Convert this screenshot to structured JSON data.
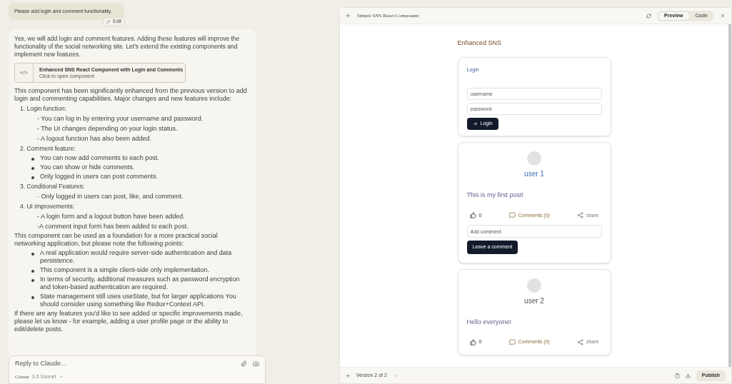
{
  "chat": {
    "user_message": "Please add login and comment functionality.",
    "edit_button": "Edit",
    "intro": "Yes, we will add login and comment features. Adding these features will improve the functionality of the social networking site. Let's extend the existing components and implement new features.",
    "artifact": {
      "icon": "</>",
      "title": "Enhanced SNS React Component with Login and Comments",
      "subtitle": "Click to open component"
    },
    "blocks": [
      {
        "kind": "para",
        "text": "This component has been significantly enhanced from the previous version to add login and commenting capabilities. Major changes and new features include:"
      },
      {
        "kind": "heading",
        "text": "1. Login function:"
      },
      {
        "kind": "dash",
        "text": "- You can log in by entering your username and password."
      },
      {
        "kind": "dash",
        "text": "- The UI changes depending on your login status."
      },
      {
        "kind": "dash",
        "text": "- A logout function has also been added."
      },
      {
        "kind": "heading",
        "text": "2. Comment feature:"
      },
      {
        "kind": "bullet",
        "text": "You can now add comments to each post."
      },
      {
        "kind": "bullet",
        "text": "You can show or hide comments."
      },
      {
        "kind": "bullet",
        "text": "Only logged in users can post comments."
      },
      {
        "kind": "heading",
        "text": "3. Conditional Features:"
      },
      {
        "kind": "dash",
        "text": "· Only logged in users can post, like, and comment."
      },
      {
        "kind": "heading",
        "text": "4. UI improvements:"
      },
      {
        "kind": "dash",
        "text": "- A login form and a logout button have been added."
      },
      {
        "kind": "dash",
        "text": "-A comment input form has been added to each post."
      },
      {
        "kind": "para",
        "text": "This component can be used as a foundation for a more practical social networking application, but please note the following points:"
      },
      {
        "kind": "bullet",
        "text": "A real application would require server-side authentication and data persistence."
      },
      {
        "kind": "bullet",
        "text": "This component is a simple client-side only implementation."
      },
      {
        "kind": "bullet",
        "text": "In terms of security, additional measures such as password encryption and token-based authentication are required."
      },
      {
        "kind": "bullet",
        "text": "State management still uses useState, but for larger applications You should consider using something like Redux+Context API."
      },
      {
        "kind": "para",
        "text": "If there are any features you'd like to see added or specific improvements made, please let us know - for example, adding a user profile page or the ability to edit/delete posts."
      }
    ],
    "reply": {
      "placeholder": "Reply to Claude...",
      "model": "Claude",
      "model_version": "3.5 Sonnet"
    }
  },
  "artifact_panel": {
    "title": "Simple SNS React Component",
    "tabs": [
      {
        "label": "Preview",
        "selected": true
      },
      {
        "label": "Code",
        "selected": false
      }
    ],
    "app": {
      "title": "Enhanced SNS",
      "login": {
        "title": "Login",
        "username_placeholder": "username",
        "password_placeholder": "password",
        "button": "Login"
      },
      "posts": [
        {
          "user": "user 1",
          "text": "This is my first post!",
          "likes": "0",
          "comments": "Comments (0)",
          "share": "share",
          "comment_form": {
            "placeholder": "Add comment",
            "button": "Leave a comment"
          }
        },
        {
          "user": "user 2",
          "text": "Hello everyone!",
          "likes": "0",
          "comments": "Comments (0)",
          "share": "share"
        }
      ]
    },
    "footer": {
      "version": "Version 2 of 2",
      "publish": "Publish"
    }
  }
}
